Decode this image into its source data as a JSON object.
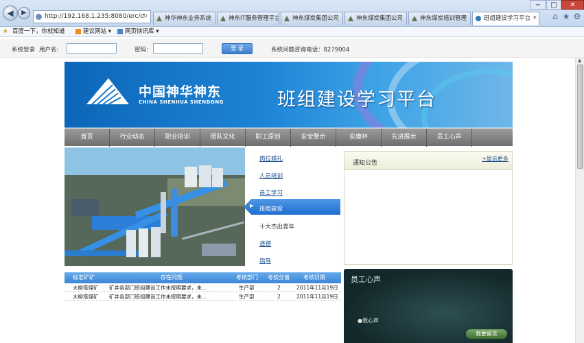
{
  "browser": {
    "address": "http://192.168.1.235:8080/erc/c",
    "tabs": [
      {
        "label": "神华神东业务系统",
        "active": false
      },
      {
        "label": "神东IT服务管理平台",
        "active": false
      },
      {
        "label": "神东煤炭集团公司",
        "active": false
      },
      {
        "label": "神东煤炭集团公司",
        "active": false
      },
      {
        "label": "神东煤炭培训管理",
        "active": false
      },
      {
        "label": "班组建设学习平台",
        "active": true
      }
    ],
    "window_controls": [
      "−",
      "□",
      "✕"
    ],
    "favorites": {
      "item1": "百度一下，你就知道",
      "item2": "建议网站 ▾",
      "item3": "网页快讯库 ▾"
    }
  },
  "login": {
    "title": "系统登录",
    "username_label": "用户名:",
    "username_value": "",
    "password_label": "密码:",
    "password_value": "",
    "button": "登 录",
    "helpdesk": "系统问题咨询电话：8279004"
  },
  "banner": {
    "logo_cn": "中国神华神东",
    "logo_en": "CHINA SHENHUA SHENDONG",
    "title": "班组建设学习平台"
  },
  "nav": [
    "首页",
    "行业动态",
    "职业培训",
    "团队文化",
    "职工原创",
    "安全警示",
    "安康杯",
    "先进展示",
    "员工心声"
  ],
  "mid_menu": {
    "items": [
      "岗位婚礼",
      "人员培训",
      "员工学习",
      "班组建设",
      "十大杰出青年",
      "道德",
      "指导"
    ],
    "active_index": 3
  },
  "notice": {
    "title": "通知公告",
    "more": "+显示更多"
  },
  "table": {
    "headers": [
      "标准矿矿",
      "存在问题",
      "考核部门",
      "考核分值",
      "考核日期"
    ],
    "rows": [
      [
        "大柳塔煤矿",
        "矿井各部门班组建设工作未按照要求，未...",
        "生产部",
        "2",
        "2011年11月19日"
      ],
      [
        "大柳塔煤矿",
        "矿井各部门班组建设工作未按照要求，未...",
        "生产部",
        "2",
        "2011年11月19日"
      ]
    ]
  },
  "staff": {
    "title": "员工心声",
    "item": "●我心声",
    "button": "我要留言"
  }
}
